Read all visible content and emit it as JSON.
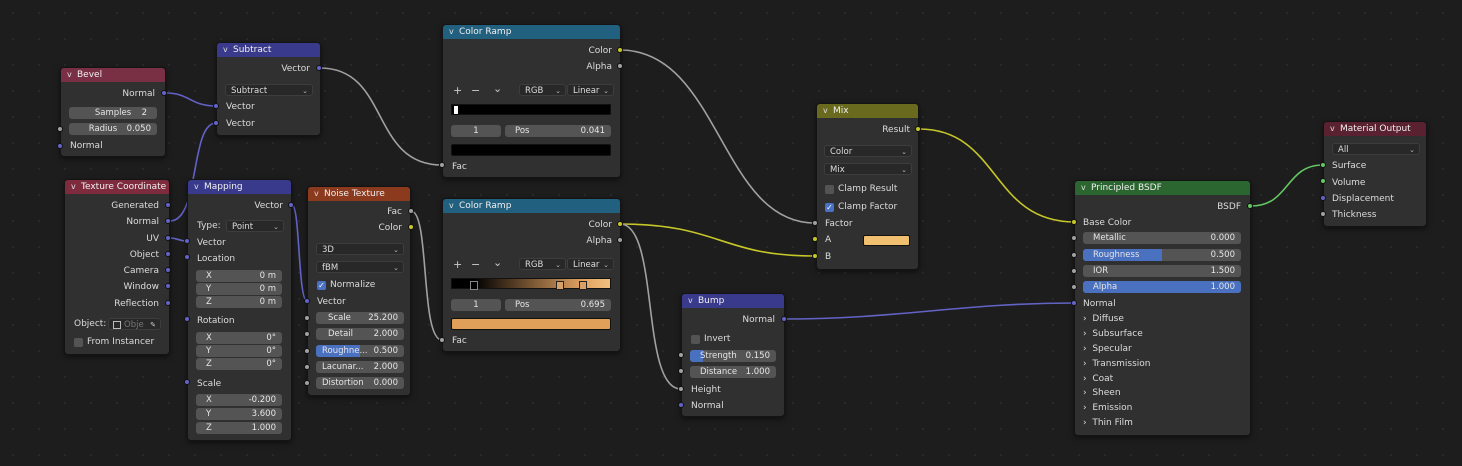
{
  "colors": {
    "bevel_header": "#7a3044",
    "vector_header": "#3a3a8c",
    "texture_header": "#8c3a1e",
    "input_header": "#7e2b3e",
    "converter_header": "#21607e",
    "color_header": "#6a6a1e",
    "shader_header": "#2b6630",
    "output_header": "#5a2230",
    "socket_vector": "#6363c7",
    "socket_color": "#c7c729",
    "socket_float": "#a1a1a1",
    "socket_shader": "#63c763",
    "ramp_end_color": "#e0a060",
    "mix_b_color": "#f0c070"
  },
  "bevel": {
    "title": "Bevel",
    "out_normal": "Normal",
    "samples_label": "Samples",
    "samples_value": "2",
    "radius_label": "Radius",
    "radius_value": "0.050",
    "in_normal": "Normal"
  },
  "subtract": {
    "title": "Subtract",
    "out_vector": "Vector",
    "operation": "Subtract",
    "in_vector1": "Vector",
    "in_vector2": "Vector"
  },
  "texcoord": {
    "title": "Texture Coordinate",
    "outputs": [
      "Generated",
      "Normal",
      "UV",
      "Object",
      "Camera",
      "Window",
      "Reflection"
    ],
    "object_label": "Object:",
    "object_placeholder": "Obje",
    "from_instancer": "From Instancer"
  },
  "mapping": {
    "title": "Mapping",
    "out_vector": "Vector",
    "type_label": "Type:",
    "type_value": "Point",
    "in_vector": "Vector",
    "location": "Location",
    "loc": [
      [
        "X",
        "0 m"
      ],
      [
        "Y",
        "0 m"
      ],
      [
        "Z",
        "0 m"
      ]
    ],
    "rotation": "Rotation",
    "rot": [
      [
        "X",
        "0°"
      ],
      [
        "Y",
        "0°"
      ],
      [
        "Z",
        "0°"
      ]
    ],
    "scale": "Scale",
    "scl": [
      [
        "X",
        "-0.200"
      ],
      [
        "Y",
        "3.600"
      ],
      [
        "Z",
        "1.000"
      ]
    ]
  },
  "noise": {
    "title": "Noise Texture",
    "out_fac": "Fac",
    "out_color": "Color",
    "dimensions": "3D",
    "type": "fBM",
    "normalize": "Normalize",
    "in_vector": "Vector",
    "fields": [
      [
        "Scale",
        "25.200"
      ],
      [
        "Detail",
        "2.000"
      ],
      [
        "Roughne...",
        "0.500"
      ],
      [
        "Lacunar...",
        "2.000"
      ],
      [
        "Distortion",
        "0.000"
      ]
    ],
    "roughness_fraction": 0.5
  },
  "ramp1": {
    "title": "Color Ramp",
    "out_color": "Color",
    "out_alpha": "Alpha",
    "tool_add": "+",
    "tool_remove": "−",
    "tool_more": "⌄",
    "color_mode": "RGB",
    "interpolation": "Linear",
    "stop_index": "1",
    "pos_label": "Pos",
    "pos_value": "0.041",
    "in_fac": "Fac"
  },
  "ramp2": {
    "title": "Color Ramp",
    "out_color": "Color",
    "out_alpha": "Alpha",
    "tool_add": "+",
    "tool_remove": "−",
    "tool_more": "⌄",
    "color_mode": "RGB",
    "interpolation": "Linear",
    "stop_index": "1",
    "pos_label": "Pos",
    "pos_value": "0.695",
    "in_fac": "Fac"
  },
  "bump": {
    "title": "Bump",
    "out_normal": "Normal",
    "invert": "Invert",
    "strength_label": "Strength",
    "strength_value": "0.150",
    "strength_fraction": 0.15,
    "distance_label": "Distance",
    "distance_value": "1.000",
    "in_height": "Height",
    "in_normal": "Normal"
  },
  "mix": {
    "title": "Mix",
    "out_result": "Result",
    "data_type": "Color",
    "blend": "Mix",
    "clamp_result": "Clamp Result",
    "clamp_factor": "Clamp Factor",
    "in_factor": "Factor",
    "in_a": "A",
    "in_b": "B"
  },
  "bsdf": {
    "title": "Principled BSDF",
    "out_bsdf": "BSDF",
    "base_color": "Base Color",
    "fields": [
      [
        "Metallic",
        "0.000"
      ],
      [
        "Roughness",
        "0.500"
      ],
      [
        "IOR",
        "1.500"
      ],
      [
        "Alpha",
        "1.000"
      ]
    ],
    "roughness_fraction": 0.5,
    "alpha_fraction": 1.0,
    "in_normal": "Normal",
    "panels": [
      "Diffuse",
      "Subsurface",
      "Specular",
      "Transmission",
      "Coat",
      "Sheen",
      "Emission",
      "Thin Film"
    ]
  },
  "output": {
    "title": "Material Output",
    "target": "All",
    "inputs": [
      "Surface",
      "Volume",
      "Displacement",
      "Thickness"
    ]
  }
}
